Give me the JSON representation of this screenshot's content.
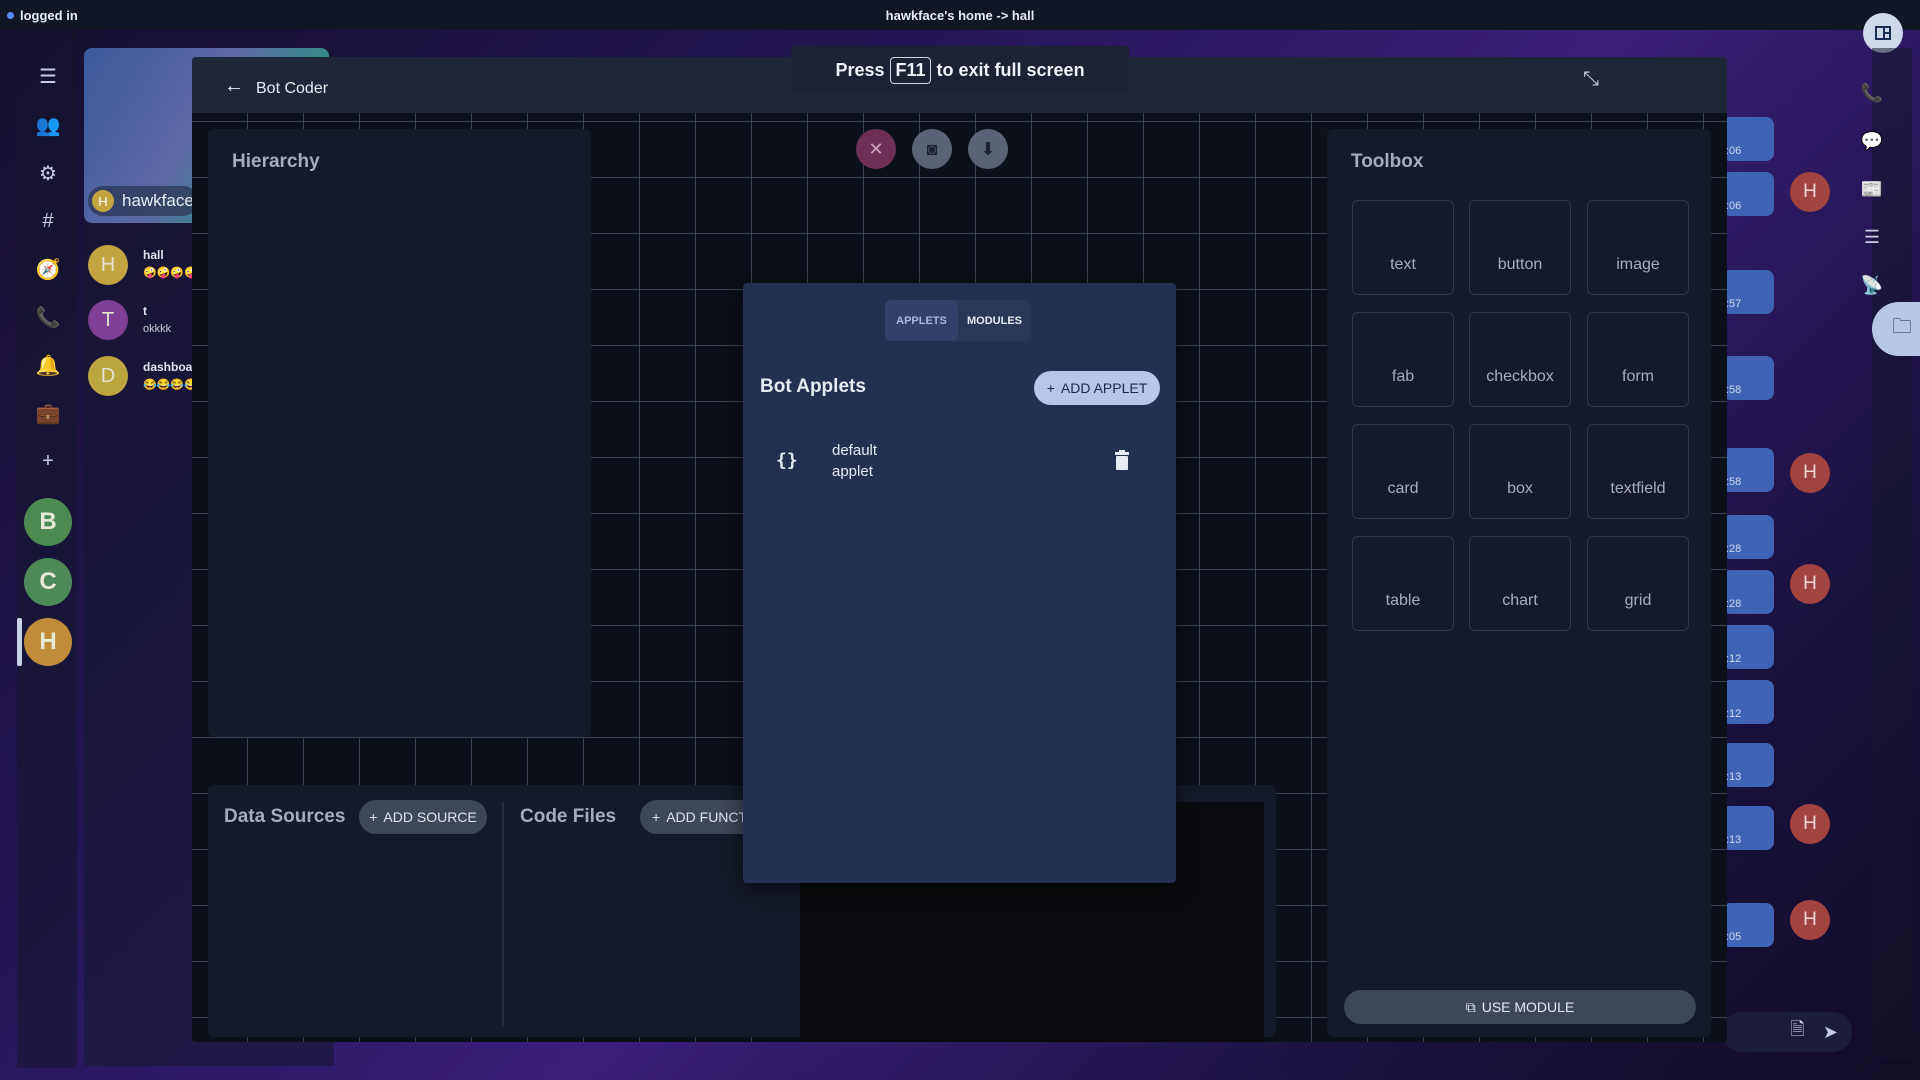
{
  "topbar": {
    "status": "logged in",
    "title": "hawkface's home -> hall"
  },
  "rail": {
    "icons": [
      "menu-icon",
      "people-icon",
      "gear-icon",
      "hashtag-icon",
      "compass-icon",
      "phone-icon",
      "bell-icon",
      "briefcase-icon",
      "plus-icon"
    ],
    "avatars": [
      {
        "letter": "B",
        "color": "#4c8a52"
      },
      {
        "letter": "C",
        "color": "#4e8a58"
      },
      {
        "letter": "H",
        "color": "#c08d3a"
      }
    ]
  },
  "channels": {
    "space_name": "hawkface",
    "space_initial": "H",
    "items": [
      {
        "initial": "H",
        "name": "hall",
        "msg": "🤪🤪🤪🤪",
        "color": "#c2a442"
      },
      {
        "initial": "T",
        "name": "t",
        "msg": "okkkk",
        "color": "#7e3f95"
      },
      {
        "initial": "D",
        "name": "dashboa",
        "msg": "😂😂😂😂",
        "color": "#bba53e"
      }
    ]
  },
  "chat": {
    "times": [
      ":06",
      ":06",
      ":57",
      ":58",
      ":58",
      ":28",
      ":28",
      ":12",
      ":12",
      ":13",
      ":13",
      ":05"
    ],
    "avatar_initial": "H"
  },
  "dialog": {
    "title": "Bot Coder",
    "hierarchy_title": "Hierarchy",
    "toolbox_title": "Toolbox",
    "tools": [
      "text",
      "button",
      "image",
      "fab",
      "checkbox",
      "form",
      "card",
      "box",
      "textfield",
      "table",
      "chart",
      "grid"
    ],
    "use_module_label": "USE MODULE",
    "data_sources_title": "Data Sources",
    "add_source_label": "ADD SOURCE",
    "code_files_title": "Code Files",
    "add_function_label": "ADD FUNCT"
  },
  "modal": {
    "tabs": [
      {
        "label": "APPLETS",
        "active": true
      },
      {
        "label": "MODULES",
        "active": false
      }
    ],
    "title": "Bot Applets",
    "add_applet_label": "ADD APPLET",
    "applets": [
      {
        "name_line1": "default",
        "name_line2": "applet"
      }
    ]
  },
  "toast": {
    "prefix": "Press",
    "key": "F11",
    "suffix": "to exit full screen"
  },
  "colors": {
    "accent": "#b7c6ea",
    "close_button": "#6e2f55",
    "canvas_button": "#5a6276"
  }
}
